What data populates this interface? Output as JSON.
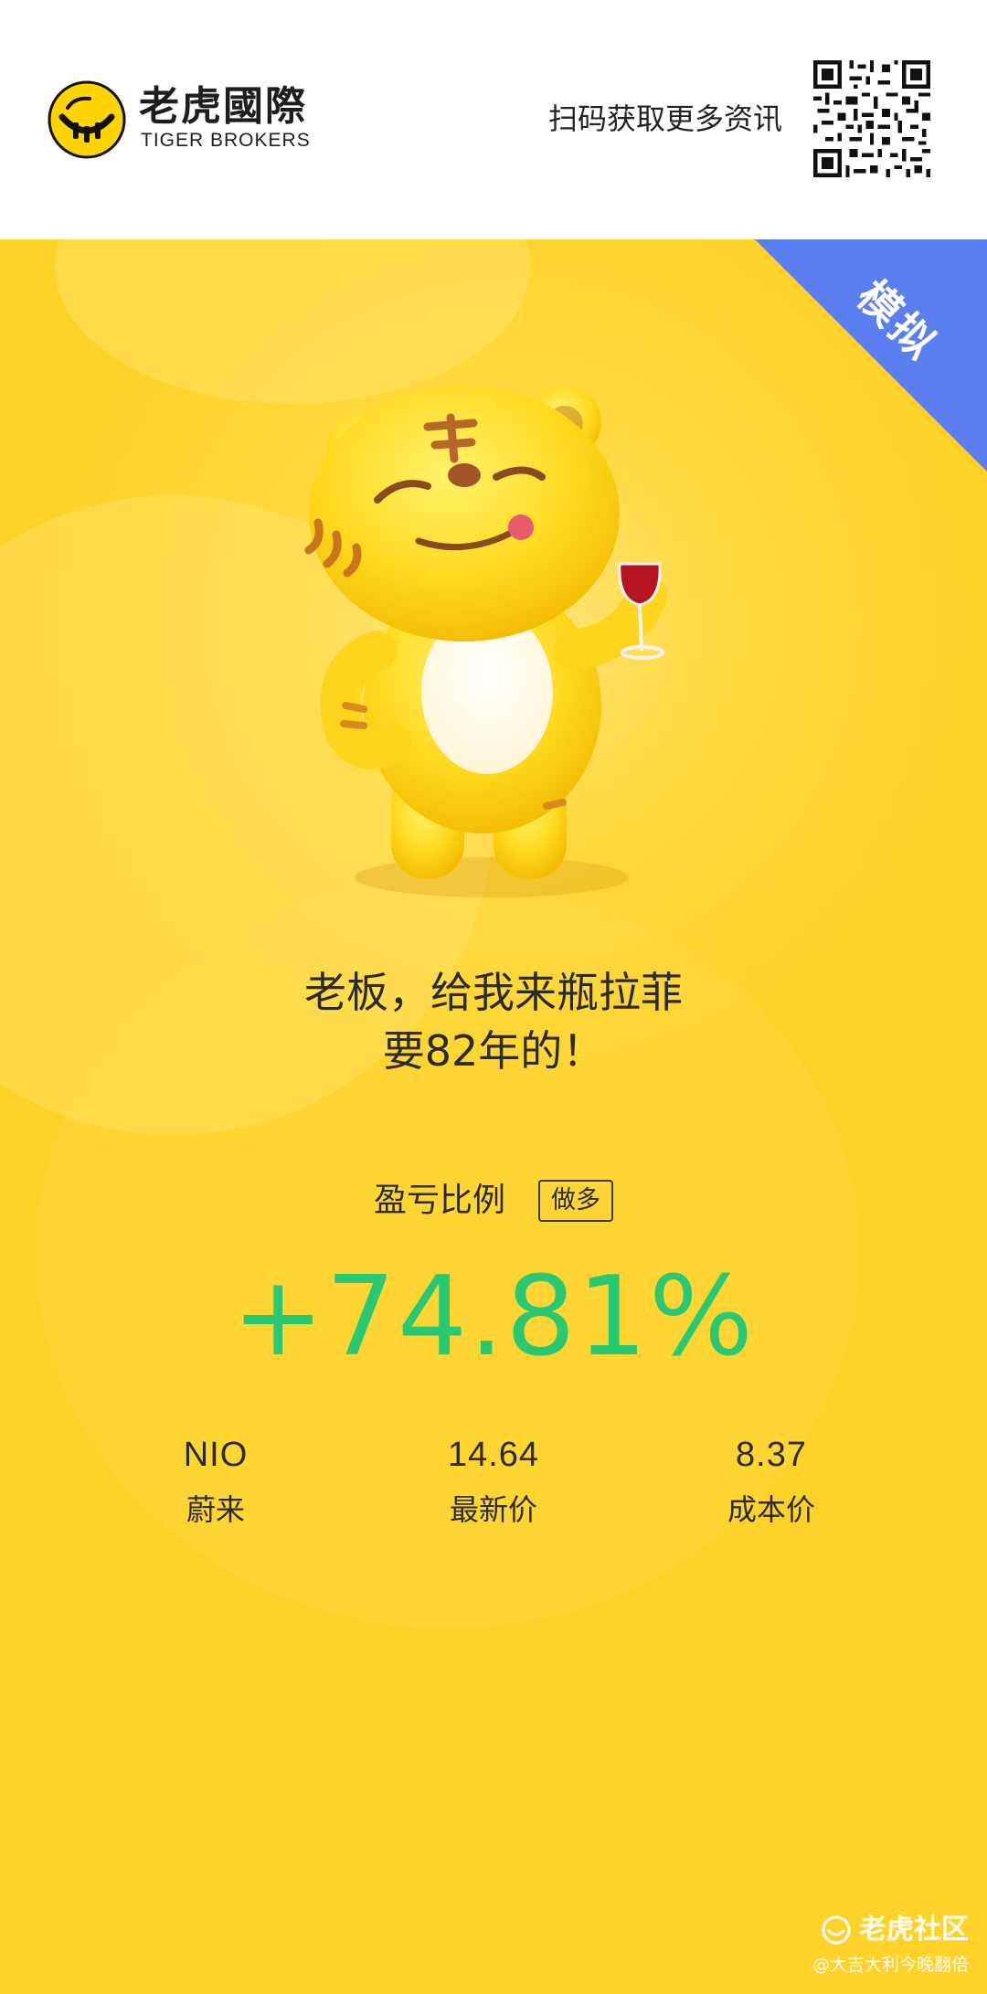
{
  "header": {
    "brand_cn": "老虎國際",
    "brand_en": "TIGER BROKERS",
    "scan_text": "扫码获取更多资讯"
  },
  "corner_badge": "模拟",
  "quote": {
    "line1": "老板，给我来瓶拉菲",
    "line2": "要82年的！"
  },
  "profit_loss": {
    "label": "盈亏比例",
    "direction_badge": "做多",
    "value": "+74.81%",
    "value_color": "#29c872"
  },
  "stats": [
    {
      "value": "NIO",
      "label": "蔚来"
    },
    {
      "value": "14.64",
      "label": "最新价"
    },
    {
      "value": "8.37",
      "label": "成本价"
    }
  ],
  "watermark": {
    "title": "老虎社区",
    "user": "@大吉大利今晚翻倍"
  },
  "colors": {
    "background_yellow": "#ffd22a",
    "corner_blue": "#5b7ff0",
    "profit_green": "#29c872"
  },
  "icons": [
    "tiger-logo-icon",
    "qr-code-icon",
    "tiger-mascot-image",
    "community-logo-icon"
  ]
}
